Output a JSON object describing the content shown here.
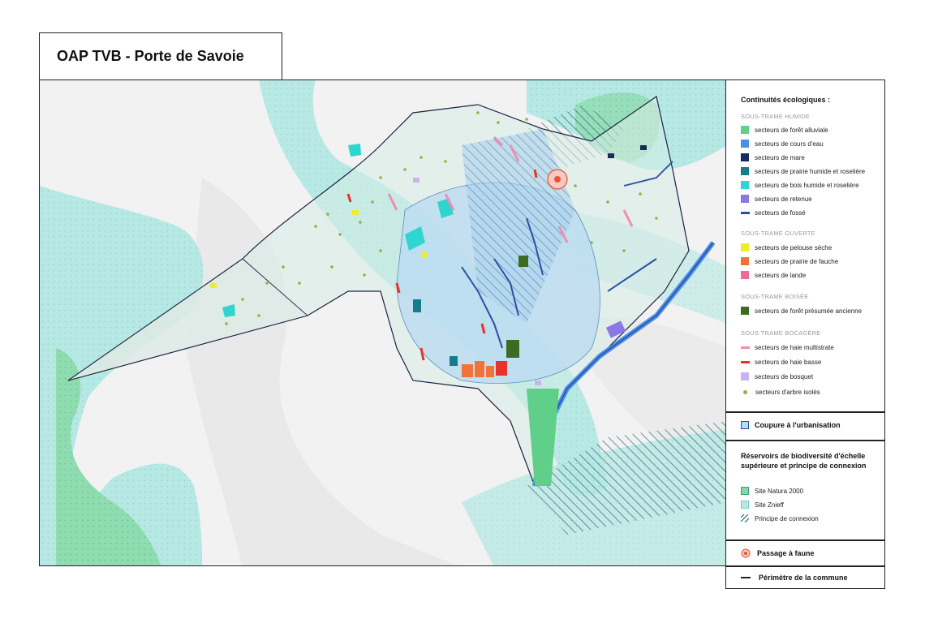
{
  "title": "OAP TVB - Porte de Savoie",
  "legend": {
    "continuites_title": "Continuités écologiques :",
    "groups": [
      {
        "subtitle": "SOUS-TRAME HUMIDE",
        "items": [
          {
            "label": "secteurs de forêt alluviale",
            "color": "#5fcf8a",
            "kind": "square"
          },
          {
            "label": "secteurs de cours d'eau",
            "color": "#4c8fe6",
            "kind": "square"
          },
          {
            "label": "secteurs de mare",
            "color": "#1b2a5e",
            "kind": "square"
          },
          {
            "label": "secteurs de prairie humide et roselière",
            "color": "#157d8a",
            "kind": "square"
          },
          {
            "label": "secteurs de bois humide et roselière",
            "color": "#2fd6d0",
            "kind": "square"
          },
          {
            "label": "secteurs de retenue",
            "color": "#8b78e6",
            "kind": "square"
          },
          {
            "label": "secteurs de fossé",
            "color": "#2b4fa8",
            "kind": "line"
          }
        ]
      },
      {
        "subtitle": "SOUS-TRAME OUVERTE",
        "items": [
          {
            "label": "secteurs de pelouse sèche",
            "color": "#f2ea2c",
            "kind": "square"
          },
          {
            "label": "secteurs de prairie de fauche",
            "color": "#f2733a",
            "kind": "square"
          },
          {
            "label": "secteurs de lande",
            "color": "#f06a9a",
            "kind": "square"
          }
        ]
      },
      {
        "subtitle": "SOUS-TRAME BOISÉE",
        "items": [
          {
            "label": "secteurs de forêt présumée ancienne",
            "color": "#3d6b24",
            "kind": "square"
          }
        ]
      },
      {
        "subtitle": "SOUS-TRAME BOCAGÈRE",
        "items": [
          {
            "label": "secteurs de haie multistrate",
            "color": "#f28cb4",
            "kind": "line"
          },
          {
            "label": "secteurs de haie basse",
            "color": "#e8322a",
            "kind": "line"
          },
          {
            "label": "secteurs de bosquet",
            "color": "#c7b2f2",
            "kind": "square"
          },
          {
            "label": "secteurs d'arbre isolés",
            "color": "#8fb53a",
            "kind": "dot"
          }
        ]
      }
    ],
    "coupure": {
      "label": "Coupure à l'urbanisation",
      "color": "#b9dbf2"
    },
    "reservoirs": {
      "title": "Réservoirs de biodiversité d'échelle supérieure et principe de connexion",
      "items": [
        {
          "label": "Site Natura 2000",
          "color": "#7fd9a8",
          "kind": "natura"
        },
        {
          "label": "Site Znieff",
          "color": "#b6e8e4",
          "kind": "znieff"
        },
        {
          "label": "Principe de connexion",
          "color": "#2f6b74",
          "kind": "hatch"
        }
      ]
    },
    "passage": {
      "label": "Passage à faune",
      "color": "#e8503a"
    },
    "perimetre": {
      "label": "Périmètre de la commune",
      "color": "#1d2240"
    }
  }
}
